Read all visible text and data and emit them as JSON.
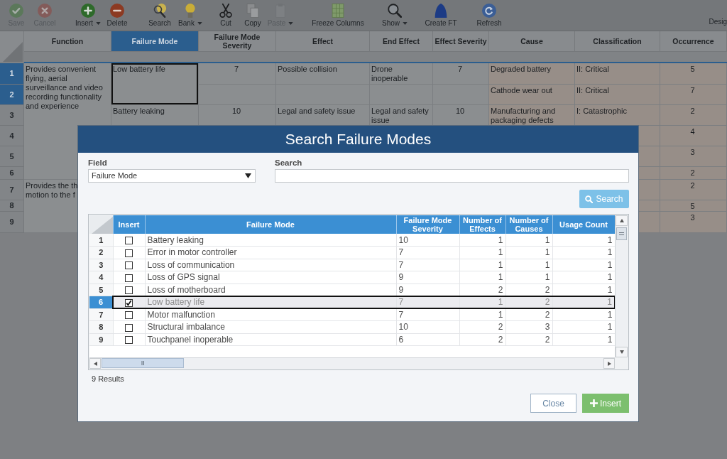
{
  "toolbar": {
    "items": [
      {
        "label": "Save",
        "disabled": true,
        "dropdown": false
      },
      {
        "label": "Cancel",
        "disabled": true,
        "dropdown": false
      },
      {
        "label": "Insert",
        "disabled": false,
        "dropdown": true
      },
      {
        "label": "Delete",
        "disabled": false,
        "dropdown": false
      },
      {
        "label": "Search",
        "disabled": false,
        "dropdown": false
      },
      {
        "label": "Bank",
        "disabled": false,
        "dropdown": true
      },
      {
        "label": "Cut",
        "disabled": false,
        "dropdown": false
      },
      {
        "label": "Copy",
        "disabled": false,
        "dropdown": false
      },
      {
        "label": "Paste",
        "disabled": true,
        "dropdown": true
      },
      {
        "label": "Freeze Columns",
        "disabled": false,
        "dropdown": false
      },
      {
        "label": "Show",
        "disabled": false,
        "dropdown": true
      },
      {
        "label": "Create FT",
        "disabled": false,
        "dropdown": false
      },
      {
        "label": "Refresh",
        "disabled": false,
        "dropdown": false
      }
    ],
    "right_label": "Desig"
  },
  "sheet": {
    "columns": [
      {
        "label": "Function",
        "selected": false
      },
      {
        "label": "Failure Mode",
        "selected": true
      },
      {
        "label": "Failure Mode Severity",
        "selected": false
      },
      {
        "label": "Effect",
        "selected": false
      },
      {
        "label": "End Effect",
        "selected": false
      },
      {
        "label": "Effect Severity",
        "selected": false
      },
      {
        "label": "Cause",
        "selected": false
      },
      {
        "label": "Classification",
        "selected": false
      },
      {
        "label": "Occurrence",
        "selected": false
      }
    ],
    "rows": [
      {
        "number": "1",
        "selected": true,
        "cells": [
          "Provides convenient flying, aerial surveillance and video recording functionality and experience",
          "Low battery life",
          "7",
          "Possible collision",
          "Drone inoperable",
          "7",
          "Degraded battery",
          "II: Critical",
          "5"
        ]
      },
      {
        "number": "2",
        "selected": true,
        "cells": [
          null,
          null,
          null,
          null,
          null,
          null,
          "Cathode wear out",
          "II: Critical",
          "7"
        ]
      },
      {
        "number": "3",
        "selected": false,
        "cells": [
          null,
          "Battery leaking",
          "10",
          "Legal and safety issue",
          "Legal and safety issue",
          "10",
          "Manufacturing and packaging defects",
          "I: Catastrophic",
          "2"
        ]
      },
      {
        "number": "4",
        "selected": false,
        "cells": [
          null,
          null,
          null,
          null,
          null,
          null,
          null,
          null,
          "4"
        ]
      },
      {
        "number": "5",
        "selected": false,
        "cells": [
          null,
          null,
          null,
          null,
          null,
          null,
          null,
          null,
          "3"
        ]
      },
      {
        "number": "6",
        "selected": false,
        "cells": [
          null,
          null,
          null,
          null,
          null,
          null,
          null,
          null,
          "2"
        ]
      },
      {
        "number": "7",
        "selected": false,
        "cells": [
          "Provides the th\nmotion to the f",
          null,
          null,
          null,
          null,
          null,
          null,
          null,
          "2"
        ]
      },
      {
        "number": "8",
        "selected": false,
        "cells": [
          null,
          null,
          null,
          null,
          null,
          null,
          null,
          null,
          "5"
        ]
      },
      {
        "number": "9",
        "selected": false,
        "cells": [
          null,
          null,
          null,
          null,
          null,
          null,
          null,
          null,
          "3"
        ]
      }
    ]
  },
  "dialog": {
    "title": "Search Failure Modes",
    "field": {
      "label": "Field",
      "value": "Failure Mode"
    },
    "search": {
      "label": "Search"
    },
    "search_button": "Search",
    "results": {
      "columns": [
        "Insert",
        "Failure Mode",
        "Failure Mode Severity",
        "Number of Effects",
        "Number of Causes",
        "Usage Count"
      ],
      "rows": [
        {
          "number": "1",
          "insert": false,
          "selected": false,
          "failure_mode": "Battery leaking",
          "severity": "10",
          "effects": "1",
          "causes": "1",
          "usage_count": "1"
        },
        {
          "number": "2",
          "insert": false,
          "selected": false,
          "failure_mode": "Error in motor controller",
          "severity": "7",
          "effects": "1",
          "causes": "1",
          "usage_count": "1"
        },
        {
          "number": "3",
          "insert": false,
          "selected": false,
          "failure_mode": "Loss of communication",
          "severity": "7",
          "effects": "1",
          "causes": "1",
          "usage_count": "1"
        },
        {
          "number": "4",
          "insert": false,
          "selected": false,
          "failure_mode": "Loss of GPS signal",
          "severity": "9",
          "effects": "1",
          "causes": "1",
          "usage_count": "1"
        },
        {
          "number": "5",
          "insert": false,
          "selected": false,
          "failure_mode": "Loss of motherboard",
          "severity": "9",
          "effects": "2",
          "causes": "2",
          "usage_count": "1"
        },
        {
          "number": "6",
          "insert": true,
          "selected": true,
          "failure_mode": "Low battery life",
          "severity": "7",
          "effects": "1",
          "causes": "2",
          "usage_count": "1"
        },
        {
          "number": "7",
          "insert": false,
          "selected": false,
          "failure_mode": "Motor malfunction",
          "severity": "7",
          "effects": "1",
          "causes": "2",
          "usage_count": "1"
        },
        {
          "number": "8",
          "insert": false,
          "selected": false,
          "failure_mode": "Structural imbalance",
          "severity": "10",
          "effects": "2",
          "causes": "3",
          "usage_count": "1"
        },
        {
          "number": "9",
          "insert": false,
          "selected": false,
          "failure_mode": "Touchpanel inoperable",
          "severity": "6",
          "effects": "2",
          "causes": "2",
          "usage_count": "1"
        }
      ]
    },
    "result_count": "9 Results",
    "buttons": [
      {
        "label": "Close",
        "kind": "secondary"
      },
      {
        "label": "Insert",
        "kind": "primary"
      }
    ]
  }
}
